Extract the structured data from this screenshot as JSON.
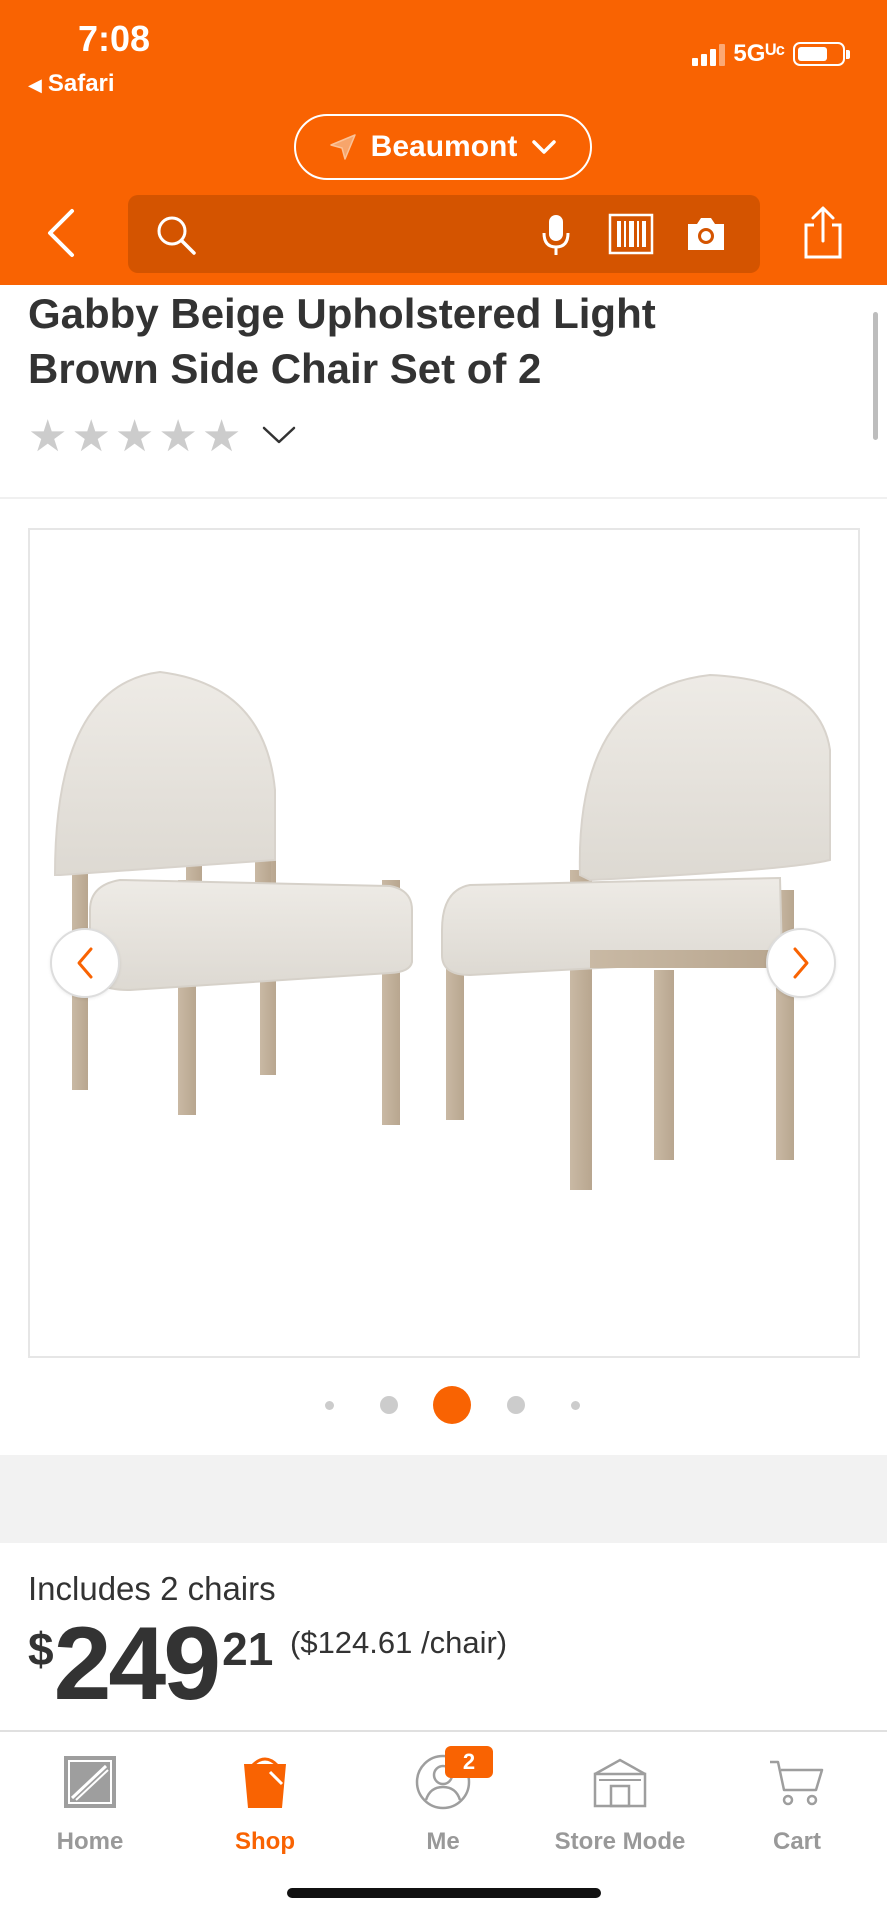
{
  "status_bar": {
    "time": "7:08",
    "back_app": "Safari",
    "network": "5Gᵁᶜ"
  },
  "header": {
    "store_name": "Beaumont",
    "search_placeholder": "",
    "accent_color": "#f96302"
  },
  "product": {
    "title_line1": "Gabby Beige Upholstered Light",
    "title_line2": "Brown Side Chair Set of 2",
    "rating_stars": 0,
    "max_stars": 5,
    "image_description_icon": "chair-set-image"
  },
  "gallery": {
    "dot_count": 5,
    "active_dot": 2
  },
  "pricing": {
    "includes": "Includes 2 chairs",
    "currency": "$",
    "dollars": "249",
    "cents": "21",
    "per_unit": "($124.61 /chair)"
  },
  "bottom_nav": {
    "items": [
      {
        "label": "Home",
        "icon": "home-depot-logo-icon"
      },
      {
        "label": "Shop",
        "icon": "shop-bucket-icon"
      },
      {
        "label": "Me",
        "icon": "user-icon",
        "badge": "2"
      },
      {
        "label": "Store Mode",
        "icon": "store-icon"
      },
      {
        "label": "Cart",
        "icon": "cart-icon"
      }
    ],
    "active": "Shop"
  }
}
